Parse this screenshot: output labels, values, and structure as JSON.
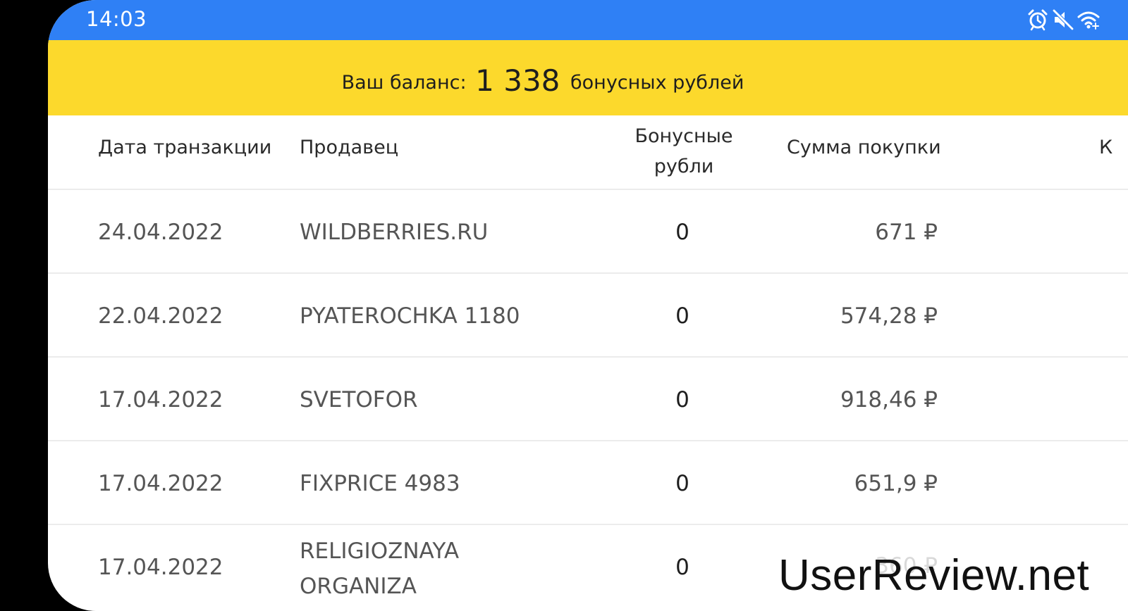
{
  "status_bar": {
    "time": "14:03",
    "icons": [
      "alarm-icon",
      "mute-icon",
      "wifi-icon"
    ],
    "color": "#2f80f5"
  },
  "balance": {
    "prefix": "Ваш баланс:",
    "amount": "1 338",
    "suffix": "бонусных рублей",
    "color": "#fcd92c"
  },
  "table": {
    "headers": {
      "date": "Дата транзакции",
      "seller": "Продавец",
      "bonus_line1": "Бонусные",
      "bonus_line2": "рубли",
      "sum": "Сумма покупки",
      "cut_off": "К"
    },
    "rows": [
      {
        "date": "24.04.2022",
        "seller": "WILDBERRIES.RU",
        "bonus": "0",
        "sum": "671 ₽"
      },
      {
        "date": "22.04.2022",
        "seller": "PYATEROCHKA 1180",
        "bonus": "0",
        "sum": "574,28 ₽"
      },
      {
        "date": "17.04.2022",
        "seller": "SVETOFOR",
        "bonus": "0",
        "sum": "918,46 ₽"
      },
      {
        "date": "17.04.2022",
        "seller": "FIXPRICE 4983",
        "bonus": "0",
        "sum": "651,9 ₽"
      },
      {
        "date": "17.04.2022",
        "seller_line1": "RELIGIOZNAYA",
        "seller_line2": "ORGANIZA",
        "bonus": "0",
        "sum": "360 ₽"
      }
    ]
  },
  "watermark": "UserReview.net"
}
